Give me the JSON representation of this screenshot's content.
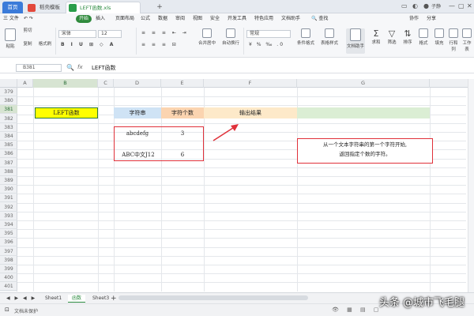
{
  "tabs": {
    "home": "首页",
    "doc": "稻壳模板",
    "file": "LEFT函数.xls",
    "plus": "+"
  },
  "window": {
    "user": "子静"
  },
  "menu": {
    "file": "三 文件",
    "start": "开始",
    "items": [
      "插入",
      "页面布局",
      "公式",
      "数据",
      "审阅",
      "视图",
      "安全",
      "开发工具",
      "特色应用",
      "文档助手"
    ],
    "search": "查找",
    "collab": "协作",
    "share": "分享"
  },
  "toolbar": {
    "paste": "粘贴",
    "cut": "剪切",
    "format_painter": "格式刷",
    "copy": "复制",
    "font_name": "宋体",
    "font_size": "12",
    "merge": "合并居中",
    "wrap": "自动换行",
    "number_format": "常规",
    "cond_format": "条件格式",
    "table_style": "表格样式",
    "doc_helper": "文档助手",
    "sum": "求和",
    "filter": "筛选",
    "sort": "排序",
    "fill": "格式",
    "cell": "填充",
    "rowcol": "行和列",
    "sheet": "工作表"
  },
  "formula": {
    "name_box": "B381",
    "fx": "fx",
    "content": "LEFT函数"
  },
  "columns": [
    "A",
    "B",
    "C",
    "D",
    "E",
    "F",
    "G"
  ],
  "rows": [
    "379",
    "380",
    "381",
    "382",
    "383",
    "384",
    "385",
    "386",
    "387",
    "388",
    "389",
    "390",
    "391",
    "392",
    "393",
    "394",
    "395",
    "396",
    "397",
    "398",
    "399",
    "400",
    "401"
  ],
  "cells": {
    "title": "LEFT函数",
    "h_str": "字符串",
    "h_count": "字符个数",
    "h_out": "输出结果",
    "r1_str": "abcdefg",
    "r1_n": "3",
    "r2_str": "ABC中文J12",
    "r2_n": "6",
    "note_line1": "从一个文本字符串的第一个字符开始,",
    "note_line2": "返回指定个数的字符。"
  },
  "sheets": [
    "Sheet1",
    "函数",
    "Sheet3"
  ],
  "status": {
    "left": "文档未保护",
    "zoom": "100%"
  },
  "watermark": "头条 @城市飞毛腿",
  "colors": {
    "accent_blue": "#3b7bd9",
    "ribbon_green": "#2f8a3c",
    "title_yellow": "#ffff00",
    "header_blue": "#cfe3f5",
    "header_orange": "#fbd4b0",
    "header_cream": "#fde9c9",
    "header_green": "#dbeed4",
    "red": "#e0313a"
  }
}
